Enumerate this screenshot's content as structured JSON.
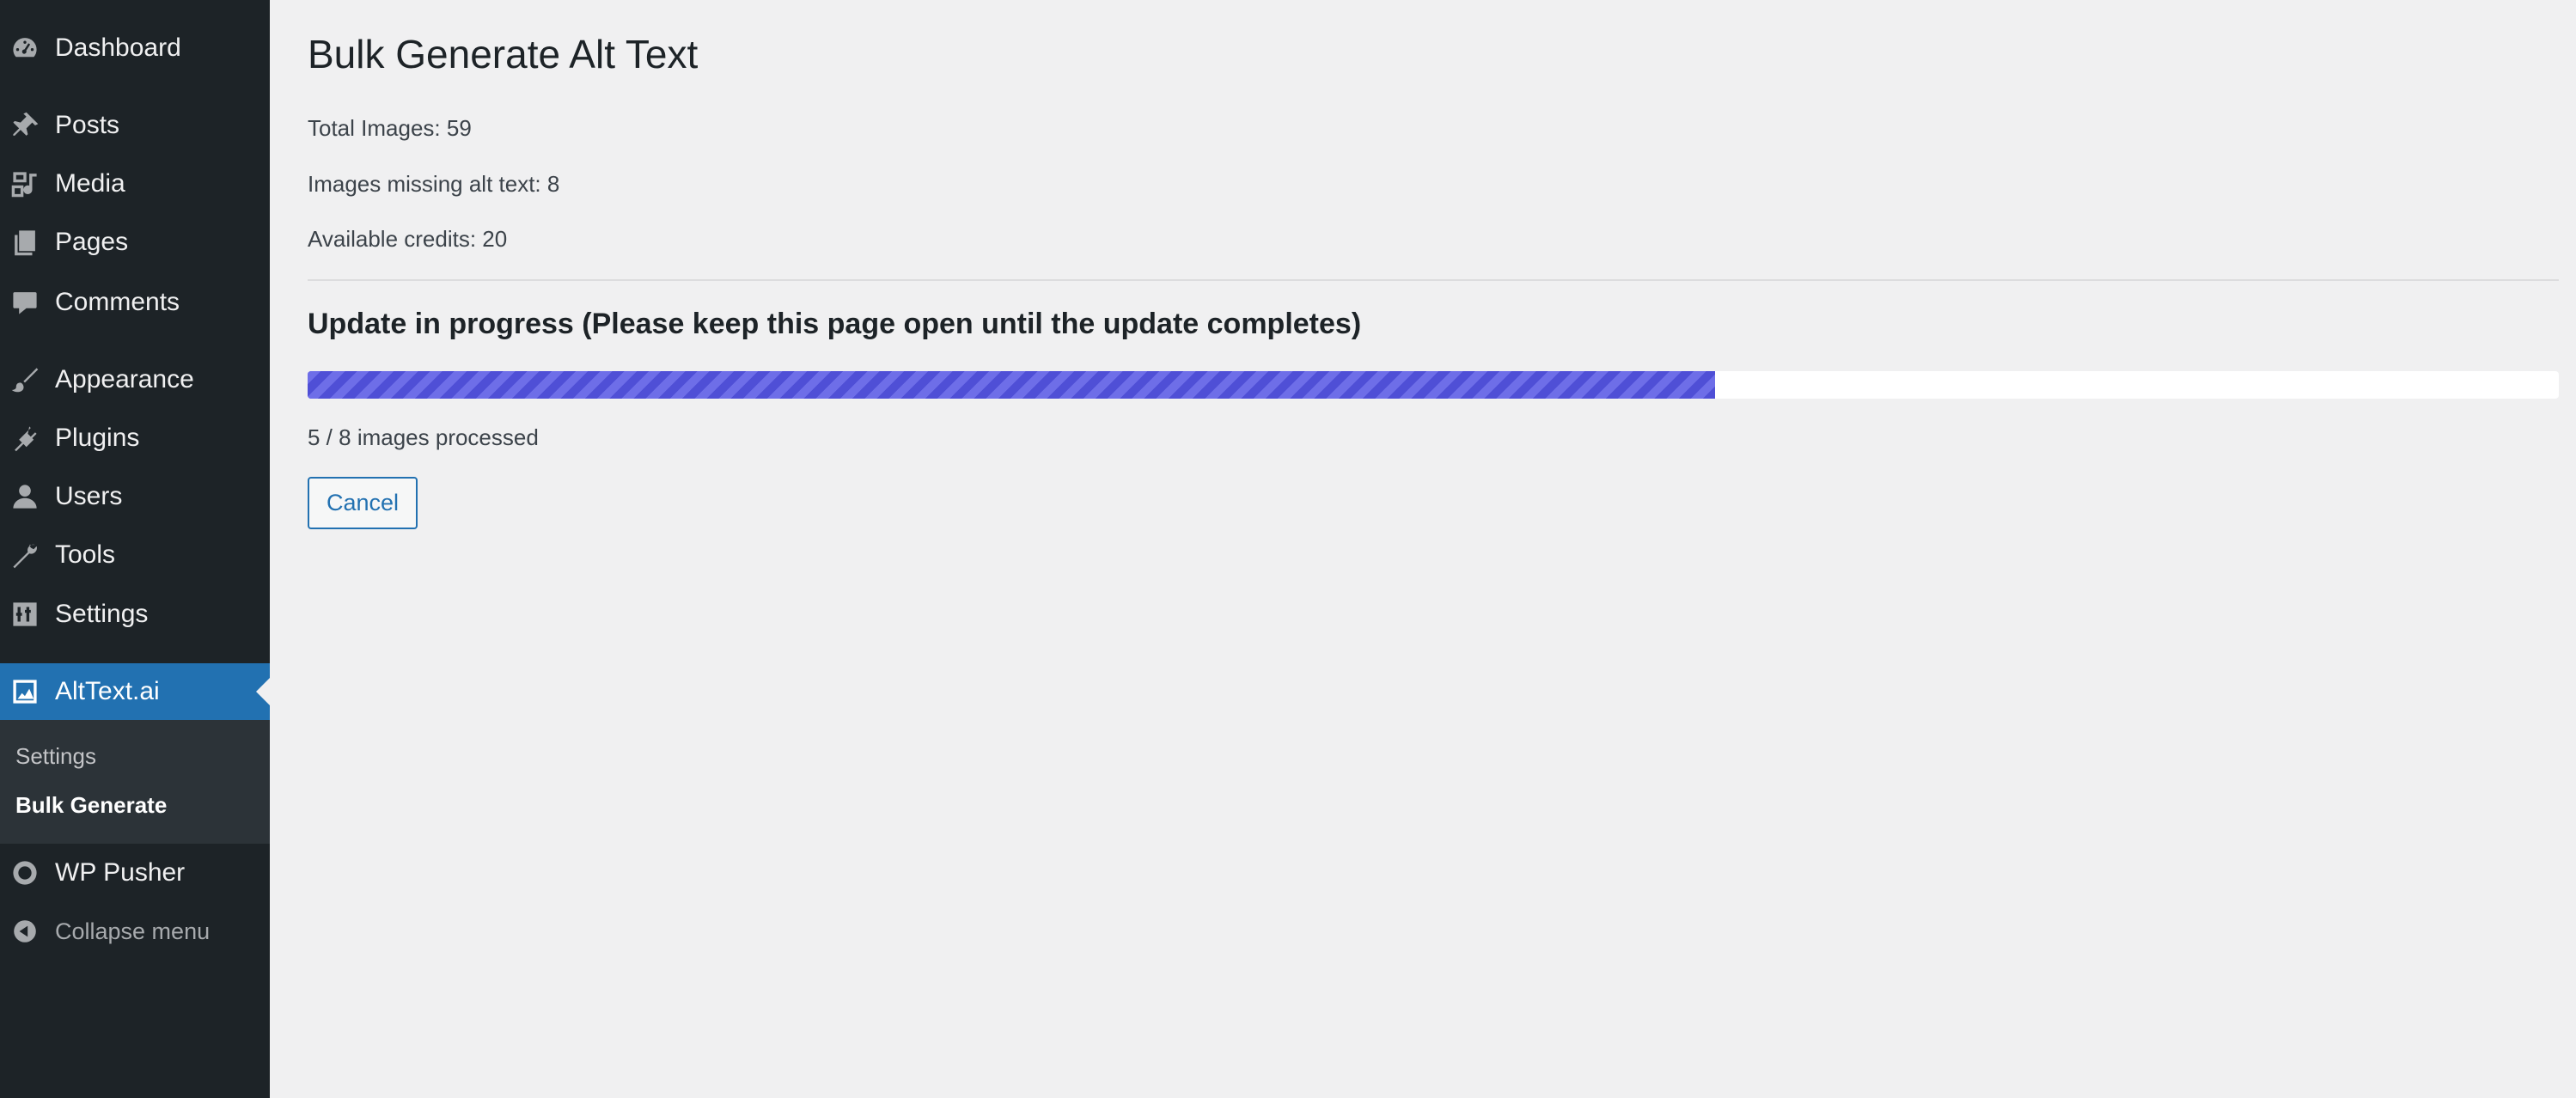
{
  "sidebar": {
    "items": [
      {
        "label": "Dashboard",
        "icon": "dashboard-icon"
      },
      {
        "label": "Posts",
        "icon": "pin-icon"
      },
      {
        "label": "Media",
        "icon": "media-icon"
      },
      {
        "label": "Pages",
        "icon": "pages-icon"
      },
      {
        "label": "Comments",
        "icon": "comment-icon"
      },
      {
        "label": "Appearance",
        "icon": "brush-icon"
      },
      {
        "label": "Plugins",
        "icon": "plugin-icon"
      },
      {
        "label": "Users",
        "icon": "user-icon"
      },
      {
        "label": "Tools",
        "icon": "wrench-icon"
      },
      {
        "label": "Settings",
        "icon": "settings-icon"
      },
      {
        "label": "AltText.ai",
        "icon": "image-icon",
        "active": true
      },
      {
        "label": "WP Pusher",
        "icon": "circle-icon"
      }
    ],
    "submenu": [
      {
        "label": "Settings"
      },
      {
        "label": "Bulk Generate",
        "current": true
      }
    ],
    "collapse_label": "Collapse menu"
  },
  "main": {
    "title": "Bulk Generate Alt Text",
    "total_images": "Total Images: 59",
    "missing_alt": "Images missing alt text: 8",
    "credits": "Available credits: 20",
    "progress_title": "Update in progress (Please keep this page open until the update completes)",
    "progress": {
      "processed": 5,
      "total": 8,
      "fraction": 0.625
    },
    "progress_text": "5 / 8 images processed",
    "cancel_label": "Cancel"
  },
  "colors": {
    "sidebar_bg": "#1d2327",
    "active_bg": "#2271b1",
    "progress_fill": "#5c5cde",
    "page_bg": "#f0f0f1"
  }
}
